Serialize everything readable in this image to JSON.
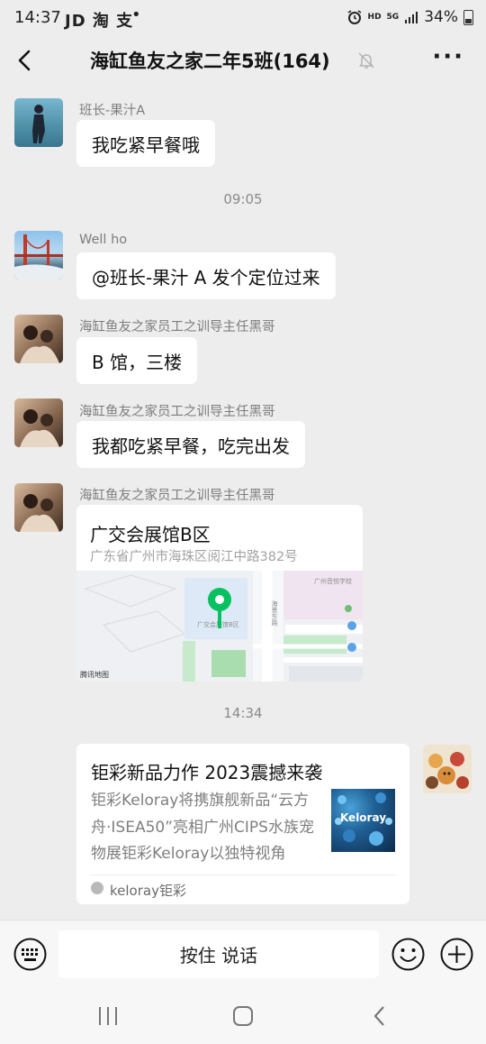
{
  "status_bar": {
    "time": "14:37",
    "apps": "JD 淘 支",
    "dot": "•",
    "hd": "HD",
    "network": "5G",
    "battery": "34%"
  },
  "header": {
    "title": "海缸鱼友之家二年5班(164)"
  },
  "messages": [
    {
      "sender": "班长-果汁A",
      "text": "我吃紧早餐哦"
    },
    {
      "timestamp": "09:05"
    },
    {
      "sender": "Well ho",
      "text": "@班长-果汁 A  发个定位过来"
    },
    {
      "sender": "海缸鱼友之家员工之训导主任黑哥",
      "text": "B 馆，三楼"
    },
    {
      "sender": "海缸鱼友之家员工之训导主任黑哥",
      "text": "我都吃紧早餐，吃完出发"
    },
    {
      "sender": "海缸鱼友之家员工之训导主任黑哥",
      "location": {
        "name": "广交会展馆B区",
        "address": "广东省广州市海珠区阅江中路382号",
        "map_provider": "腾讯地图",
        "map_label_venue": "广交会展馆B区",
        "map_label_school": "广州音悦学校",
        "map_label_road": "海景东路"
      }
    },
    {
      "timestamp": "14:34"
    },
    {
      "link": {
        "title": "钜彩新品力作 2023震撼来袭",
        "description": "钜彩Keloray将携旗舰新品“云方舟·ISEA50”亮相广州CIPS水族宠物展钜彩Keloray以独特视角",
        "thumb_text": "Keloray",
        "source": "keloray钜彩"
      }
    }
  ],
  "input_bar": {
    "hold_to_talk": "按住 说话"
  },
  "colors": {
    "background": "#ededed",
    "bubble": "#ffffff",
    "map_pin": "#07c160"
  },
  "icons": [
    "back-arrow-icon",
    "mute-bell-icon",
    "more-icon",
    "voice-keyboard-icon",
    "emoji-icon",
    "plus-icon",
    "nav-recents-icon",
    "nav-home-icon",
    "nav-back-icon"
  ]
}
